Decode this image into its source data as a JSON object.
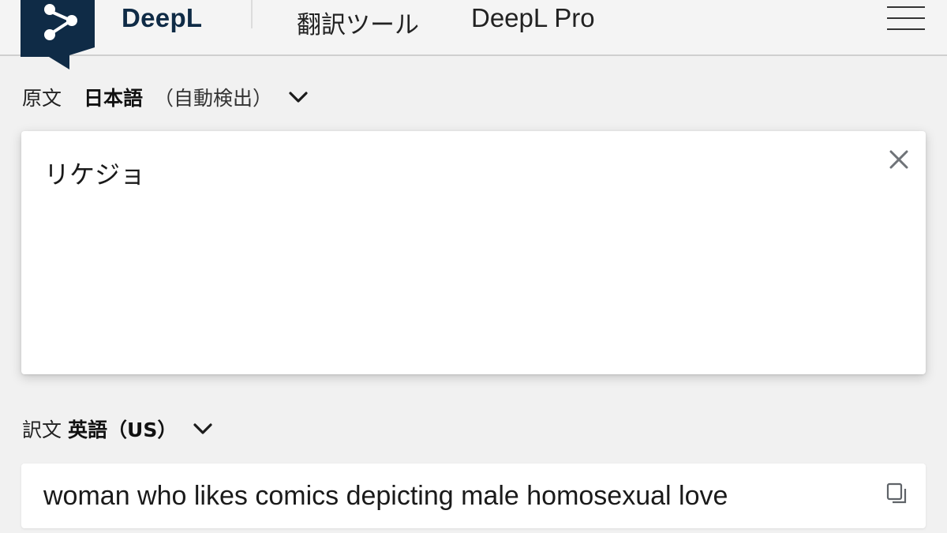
{
  "header": {
    "brand": "DeepL",
    "nav": [
      {
        "label": "翻訳ツール"
      },
      {
        "label": "DeepL Pro"
      }
    ],
    "logo_icon": "deepl-share-node-icon",
    "menu_icon": "hamburger-menu-icon"
  },
  "source": {
    "prefix": "原文",
    "language": "日本語",
    "note": "（自動検出）",
    "text": "リケジョ",
    "clear_icon": "close-icon"
  },
  "target": {
    "prefix": "訳文",
    "language": "英語（US）",
    "text": "woman who likes comics depicting male homosexual love",
    "copy_icon": "copy-icon"
  },
  "colors": {
    "brand_navy": "#0f2b46",
    "background": "#f1f1f1",
    "card": "#ffffff"
  }
}
